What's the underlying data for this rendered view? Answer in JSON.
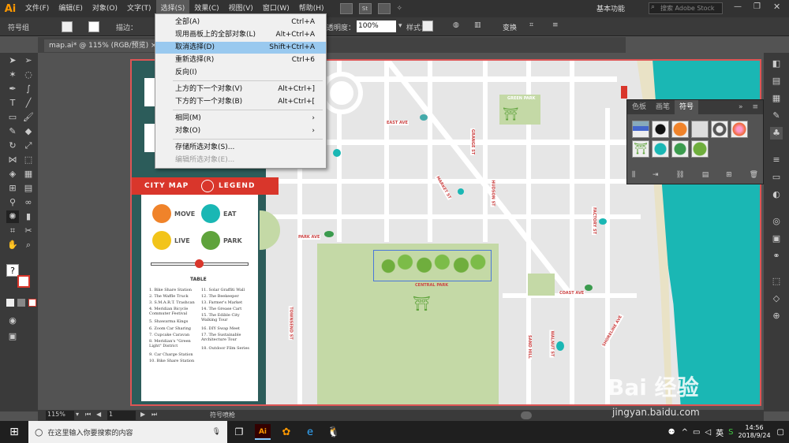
{
  "app": {
    "logo": "Ai"
  },
  "menubar": {
    "items": [
      "文件(F)",
      "编辑(E)",
      "对象(O)",
      "文字(T)",
      "选择(S)",
      "效果(C)",
      "视图(V)",
      "窗口(W)",
      "帮助(H)"
    ],
    "workspace": "基本功能",
    "search_placeholder": "搜索 Adobe Stock",
    "st_label": "St"
  },
  "controlbar": {
    "group_label": "符号组",
    "stroke_label": "描边：",
    "opacity_label": "透明度：",
    "opacity_value": "100%",
    "style_label": "样式：",
    "transform_label": "变换"
  },
  "document": {
    "tab_title": "map.ai* @ 115% (RGB/预览)"
  },
  "select_menu": {
    "items": [
      {
        "label": "全部(A)",
        "shortcut": "Ctrl+A"
      },
      {
        "label": "现用画板上的全部对象(L)",
        "shortcut": "Alt+Ctrl+A"
      },
      {
        "label": "取消选择(D)",
        "shortcut": "Shift+Ctrl+A"
      },
      {
        "label": "重新选择(R)",
        "shortcut": "Ctrl+6"
      },
      {
        "label": "反向(I)",
        "shortcut": ""
      },
      {
        "label": "上方的下一个对象(V)",
        "shortcut": "Alt+Ctrl+]"
      },
      {
        "label": "下方的下一个对象(B)",
        "shortcut": "Alt+Ctrl+["
      },
      {
        "label": "相同(M)",
        "shortcut": "›"
      },
      {
        "label": "对象(O)",
        "shortcut": "›"
      },
      {
        "label": "存储所选对象(S)...",
        "shortcut": ""
      },
      {
        "label": "编辑所选对象(E)...",
        "shortcut": ""
      }
    ]
  },
  "symbols_panel": {
    "tabs": [
      "色板",
      "画笔",
      "符号"
    ]
  },
  "map": {
    "banner_left": "CITY MAP",
    "banner_right": "LEGEND",
    "legend": {
      "move": "MOVE",
      "eat": "EAT",
      "live": "LIVE",
      "park": "PARK"
    },
    "table_title": "TABLE",
    "table_left": [
      "1. Bike Share Station",
      "2. The Waffle Truck",
      "3. S.M.A.R.T. Trashcan",
      "4. Meridian Bicycle Commuter Festival",
      "5. Shawarma Kings",
      "6. Zoom Car Sharing",
      "7. Cupcake Caravan",
      "8. Meridian's \"Green Light\" District",
      "9. Car Charge Station",
      "10. Bike Share Station"
    ],
    "table_right": [
      "11. Solar Graffiti Wall",
      "12. The Beekeeper",
      "13. Farmer's Market",
      "14. The Grease Cart",
      "15. The Edible City Walking Tour",
      "16. DIY Swap Meet",
      "17. The Sustainable Architecture Tour",
      "18. Outdoor Film Series"
    ],
    "streets": {
      "east": "EAST AVE",
      "market": "MARKET ST",
      "hudson": "HUDSON ST",
      "grange": "GRANGE ST",
      "factory": "FACTORY ST",
      "park": "PARK AVE",
      "coast": "COAST AVE",
      "townsend": "TOWNSEND ST",
      "sand": "SAND HILL",
      "walnut": "WALNUT ST",
      "shoreline": "SHORELINE AVE",
      "central": "CENTRAL PARK",
      "green": "GREEN PARK"
    }
  },
  "status": {
    "zoom": "115%",
    "page": "1",
    "tool": "符号喷枪"
  },
  "taskbar": {
    "search_placeholder": "在这里输入你要搜索的内容",
    "time": "14:56",
    "date": "2018/9/24",
    "ai_label": "Ai"
  },
  "watermark": {
    "brand": "Bai 经验",
    "url": "jingyan.baidu.com"
  },
  "colors": {
    "accent": "#d9362b",
    "teal": "#1ab7b4",
    "park": "#c4d9a6",
    "highlight": "#99c9ef"
  }
}
